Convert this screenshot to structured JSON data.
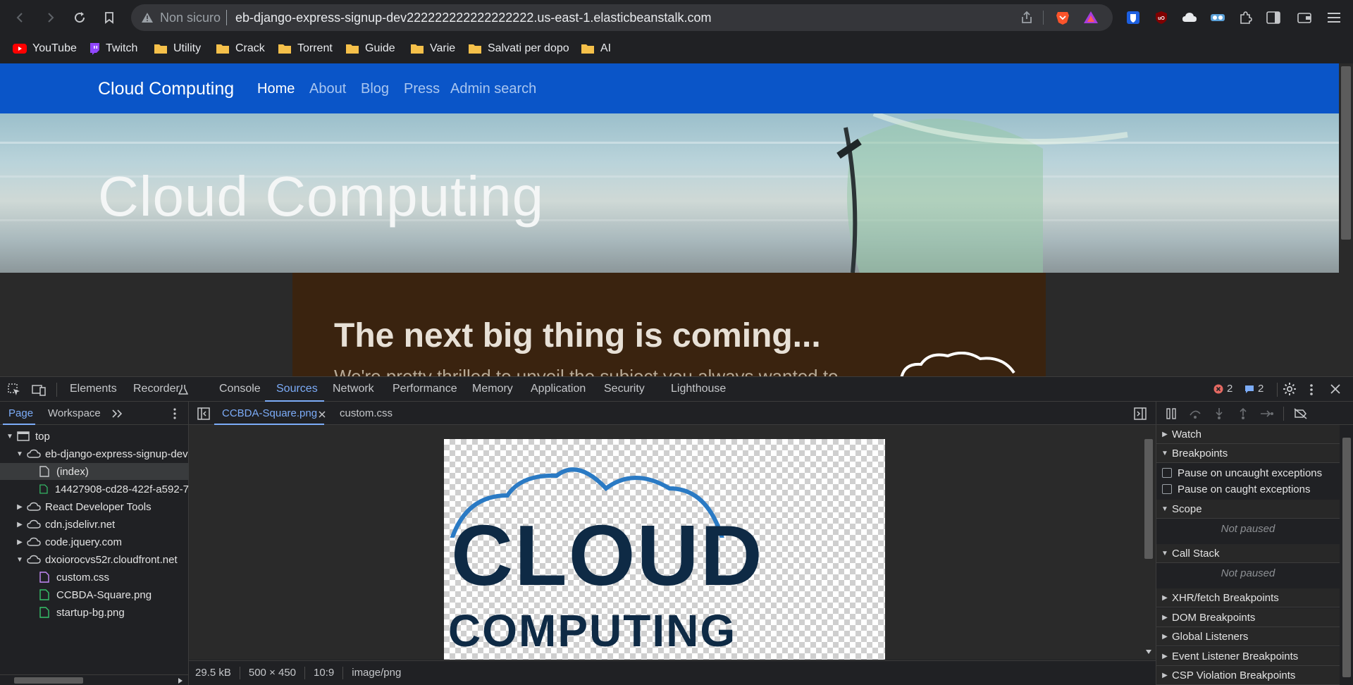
{
  "browser": {
    "security_label": "Non sicuro",
    "url": "eb-django-express-signup-dev222222222222222222.us-east-1.elasticbeanstalk.com",
    "bookmarks": [
      {
        "label": "YouTube",
        "icon": "youtube-icon"
      },
      {
        "label": "Twitch",
        "icon": "twitch-icon"
      },
      {
        "label": "Utility",
        "icon": "folder-icon"
      },
      {
        "label": "Crack",
        "icon": "folder-icon"
      },
      {
        "label": "Torrent",
        "icon": "folder-icon"
      },
      {
        "label": "Guide",
        "icon": "folder-icon"
      },
      {
        "label": "Varie",
        "icon": "folder-icon"
      },
      {
        "label": "Salvati per dopo",
        "icon": "folder-icon"
      },
      {
        "label": "AI",
        "icon": "folder-icon"
      }
    ]
  },
  "site": {
    "brand": "Cloud Computing",
    "nav": [
      "Home",
      "About",
      "Blog",
      "Press",
      "Admin search"
    ],
    "hero_title": "Cloud Computing",
    "card_title": "The next big thing is coming...",
    "card_subtitle": "We're pretty thrilled to unveil the subject you always wanted to",
    "colors": {
      "navbar": "#0a55c8",
      "card": "#3a230f"
    }
  },
  "devtools": {
    "tabs": [
      "Elements",
      "Recorder",
      "Console",
      "Sources",
      "Network",
      "Performance",
      "Memory",
      "Application",
      "Security",
      "Lighthouse"
    ],
    "active_tab": "Sources",
    "errors_count": "2",
    "messages_count": "2",
    "navigator_tabs": [
      "Page",
      "Workspace"
    ],
    "tree": [
      {
        "label": "top"
      },
      {
        "label": "eb-django-express-signup-dev"
      },
      {
        "label": "(index)"
      },
      {
        "label": "14427908-cd28-422f-a592-7"
      },
      {
        "label": "React Developer Tools"
      },
      {
        "label": "cdn.jsdelivr.net"
      },
      {
        "label": "code.jquery.com"
      },
      {
        "label": "dxoiorocvs52r.cloudfront.net"
      },
      {
        "label": "custom.css"
      },
      {
        "label": "CCBDA-Square.png"
      },
      {
        "label": "startup-bg.png"
      }
    ],
    "editor_tabs": [
      "CCBDA-Square.png",
      "custom.css"
    ],
    "image_text": {
      "line1": "CLOUD",
      "line2": "COMPUTING"
    },
    "status": {
      "size": "29.5 kB",
      "dimensions": "500 × 450",
      "ratio": "10:9",
      "mime": "image/png"
    },
    "debugger": {
      "watch": "Watch",
      "breakpoints": "Breakpoints",
      "pause_uncaught": "Pause on uncaught exceptions",
      "pause_caught": "Pause on caught exceptions",
      "scope": "Scope",
      "not_paused": "Not paused",
      "call_stack": "Call Stack",
      "sections": [
        "XHR/fetch Breakpoints",
        "DOM Breakpoints",
        "Global Listeners",
        "Event Listener Breakpoints",
        "CSP Violation Breakpoints"
      ]
    }
  }
}
